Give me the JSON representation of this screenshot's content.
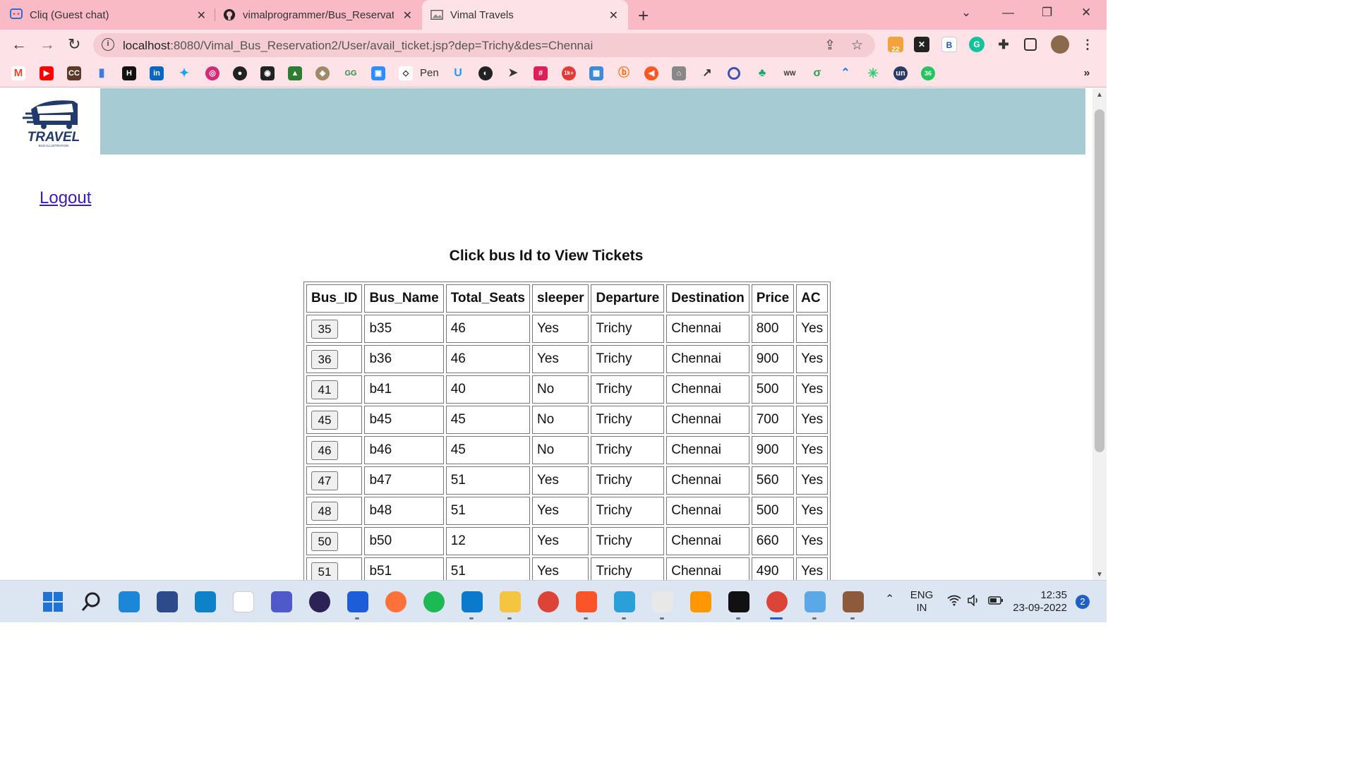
{
  "browser": {
    "tabs": [
      {
        "title": "Cliq (Guest chat)",
        "active": false
      },
      {
        "title": "vimalprogrammer/Bus_Reservatio",
        "active": false
      },
      {
        "title": "Vimal Travels",
        "active": true
      }
    ],
    "url_host": "localhost",
    "url_path": ":8080/Vimal_Bus_Reservation2/User/avail_ticket.jsp?dep=Trichy&des=Chennai",
    "bookmarks": {
      "pen_label": "Pen"
    },
    "extension_badge": "22"
  },
  "page": {
    "logo_text": "TRAVEL",
    "logo_subtext": "BUS ILLUSTRATION",
    "logout_label": "Logout",
    "heading": "Click bus Id to View Tickets",
    "table": {
      "headers": [
        "Bus_ID",
        "Bus_Name",
        "Total_Seats",
        "sleeper",
        "Departure",
        "Destination",
        "Price",
        "AC"
      ],
      "rows": [
        [
          "35",
          "b35",
          "46",
          "Yes",
          "Trichy",
          "Chennai",
          "800",
          "Yes"
        ],
        [
          "36",
          "b36",
          "46",
          "Yes",
          "Trichy",
          "Chennai",
          "900",
          "Yes"
        ],
        [
          "41",
          "b41",
          "40",
          "No",
          "Trichy",
          "Chennai",
          "500",
          "Yes"
        ],
        [
          "45",
          "b45",
          "45",
          "No",
          "Trichy",
          "Chennai",
          "700",
          "Yes"
        ],
        [
          "46",
          "b46",
          "45",
          "No",
          "Trichy",
          "Chennai",
          "900",
          "Yes"
        ],
        [
          "47",
          "b47",
          "51",
          "Yes",
          "Trichy",
          "Chennai",
          "560",
          "Yes"
        ],
        [
          "48",
          "b48",
          "51",
          "Yes",
          "Trichy",
          "Chennai",
          "500",
          "Yes"
        ],
        [
          "50",
          "b50",
          "12",
          "Yes",
          "Trichy",
          "Chennai",
          "660",
          "Yes"
        ],
        [
          "51",
          "b51",
          "51",
          "Yes",
          "Trichy",
          "Chennai",
          "490",
          "Yes"
        ]
      ]
    }
  },
  "taskbar": {
    "lang_line1": "ENG",
    "lang_line2": "IN",
    "time": "12:35",
    "date": "23-09-2022",
    "notification_count": "2"
  },
  "colors": {
    "tabstrip": "#f9b9c5",
    "toolbar": "#fde3e8",
    "banner": "#a6cbd3",
    "logout_link": "#3a1ac2"
  }
}
